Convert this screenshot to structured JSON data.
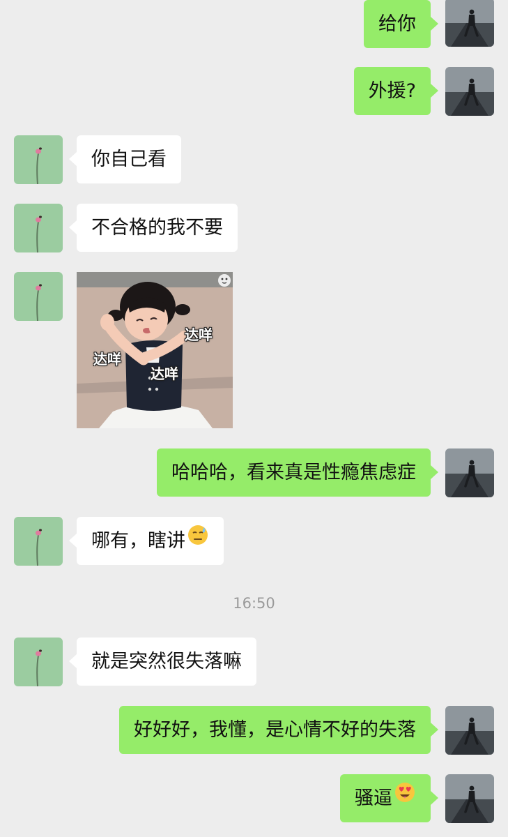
{
  "messages": [
    {
      "sender": "self",
      "text": "给你"
    },
    {
      "sender": "self",
      "text": "外援?"
    },
    {
      "sender": "other",
      "text": "你自己看"
    },
    {
      "sender": "other",
      "text": "不合格的我不要"
    },
    {
      "sender": "other",
      "type": "sticker",
      "sticker_captions": [
        "达咩",
        "达咩",
        "达咩"
      ]
    },
    {
      "sender": "self",
      "text": "哈哈哈，看来真是性瘾焦虑症"
    },
    {
      "sender": "other",
      "text": "哪有，瞎讲",
      "emoji": "sweat-emoji"
    },
    {
      "sender": "other",
      "text": "就是突然很失落嘛"
    },
    {
      "sender": "self",
      "text": "好好好，我懂，是心情不好的失落"
    },
    {
      "sender": "self",
      "text": "骚逼",
      "emoji": "heart-eyes-drool-emoji"
    }
  ],
  "timestamp": "16:50",
  "colors": {
    "background": "#ededed",
    "self_bubble": "#95ec69",
    "other_bubble": "#ffffff",
    "other_avatar": "#9bcca0",
    "timestamp_text": "#9a9a9a"
  }
}
